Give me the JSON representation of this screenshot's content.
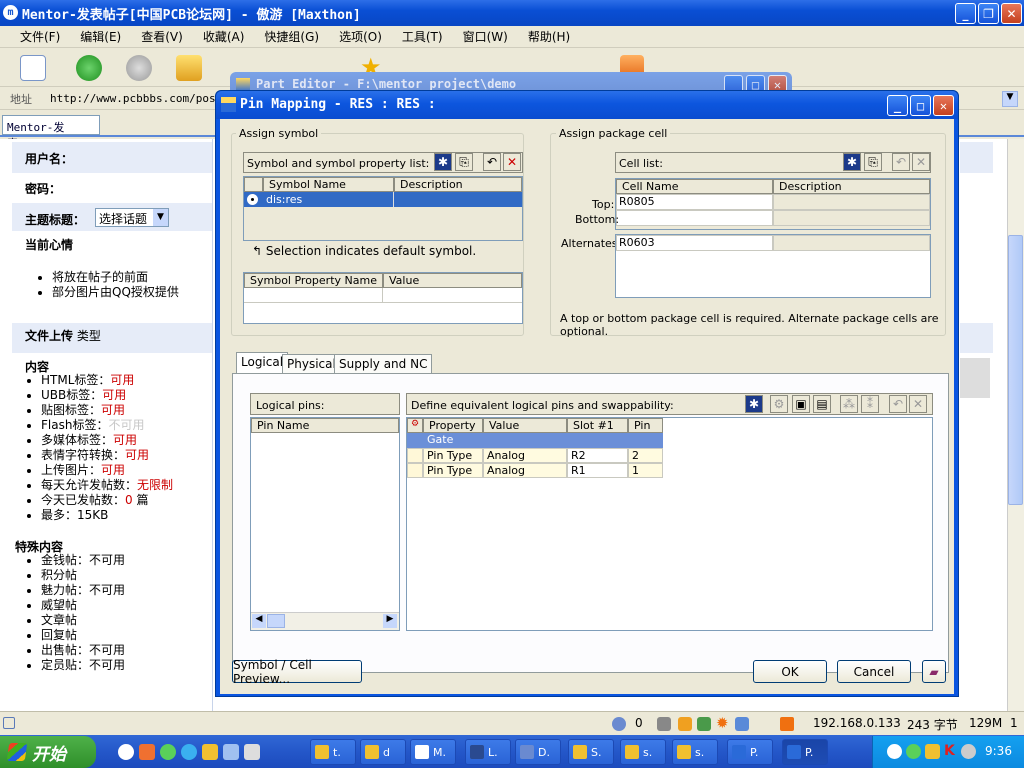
{
  "browser": {
    "title": "Mentor-发表帖子[中国PCB论坛网] - 傲游 [Maxthon]",
    "menu": [
      "文件(F)",
      "编辑(E)",
      "查看(V)",
      "收藏(A)",
      "快捷组(G)",
      "选项(O)",
      "工具(T)",
      "窗口(W)",
      "帮助(H)"
    ],
    "address_label": "地址",
    "address_value": "http://www.pcbbbs.com/pos",
    "tab_label": "Mentor-发表..."
  },
  "webpage": {
    "username_label": "用户名：",
    "password_label": "密码：",
    "topic_label": "主题标题：",
    "topic_select": "选择话题",
    "mood_label": "当前心情",
    "mood_items": [
      "将放在帖子的前面",
      "部分图片由QQ授权提供"
    ],
    "upload_label": "文件上传",
    "upload_type": "类型",
    "content_label": "内容",
    "content_items": [
      {
        "label": "HTML标签：",
        "value": "可用",
        "color": "#cc0000"
      },
      {
        "label": "UBB标签：",
        "value": "可用",
        "color": "#cc0000"
      },
      {
        "label": "贴图标签：",
        "value": "可用",
        "color": "#cc0000"
      },
      {
        "label": "Flash标签：",
        "value": "不可用",
        "color": "#c8c8c8"
      },
      {
        "label": "多媒体标签：",
        "value": "可用",
        "color": "#cc0000"
      },
      {
        "label": "表情字符转换：",
        "value": "可用",
        "color": "#cc0000"
      },
      {
        "label": "上传图片：",
        "value": "可用",
        "color": "#cc0000"
      },
      {
        "label": "每天允许发帖数：",
        "value": "无限制",
        "color": "#cc0000"
      },
      {
        "label": "今天已发帖数：",
        "value": "0",
        "color": "#cc0000",
        "suffix": " 篇"
      },
      {
        "label": "最多：15KB",
        "value": "",
        "color": "#000000"
      }
    ],
    "special_label": "特殊内容",
    "special_items": [
      "金钱帖：不可用",
      "积分帖",
      "魅力帖：不可用",
      "威望帖",
      "文章帖",
      "回复帖",
      "出售帖：不可用",
      "定员贴：不可用"
    ]
  },
  "part_editor": {
    "title": "Part Editor - F:\\mentor project\\demo"
  },
  "dialog": {
    "title": "Pin Mapping - RES : RES :",
    "assign_symbol": {
      "group_label": "Assign symbol",
      "list_label": "Symbol and symbol property list:",
      "columns": [
        "Symbol Name",
        "Description"
      ],
      "rows": [
        {
          "name": "dis:res",
          "description": ""
        }
      ],
      "hint": "Selection indicates default symbol.",
      "property_columns": [
        "Symbol Property Name",
        "Value"
      ]
    },
    "assign_package": {
      "group_label": "Assign package cell",
      "list_label": "Cell list:",
      "columns": [
        "Cell Name",
        "Description"
      ],
      "top_label": "Top:",
      "top_value": "R0805",
      "bottom_label": "Bottom:",
      "bottom_value": "",
      "alternates_label": "Alternates:",
      "alternates_value": "R0603",
      "note": "A top or bottom package cell is required.  Alternate package cells are optional."
    },
    "tabs": [
      "Logical",
      "Physical",
      "Supply and NC"
    ],
    "active_tab": "Logical",
    "logical": {
      "pins_label": "Logical pins:",
      "pin_column": "Pin Name",
      "define_label": "Define equivalent logical pins and swappability:",
      "columns": [
        "Property",
        "Value",
        "Slot #1",
        "Pin #"
      ],
      "gate_label": "Gate",
      "rows": [
        {
          "property": "Pin Type",
          "value": "Analog",
          "slot": "R2",
          "pin": "2"
        },
        {
          "property": "Pin Type",
          "value": "Analog",
          "slot": "R1",
          "pin": "1"
        }
      ]
    },
    "preview_button": "Symbol / Cell Preview...",
    "ok_button": "OK",
    "cancel_button": "Cancel"
  },
  "statusbar": {
    "count": "0",
    "ip": "192.168.0.133",
    "bytes": "243 字节",
    "mem": "129M",
    "num": "1"
  },
  "taskbar": {
    "start": "开始",
    "tasks": [
      "t.",
      "d",
      "M.",
      "L.",
      "D.",
      "S.",
      "s.",
      "s.",
      "P.",
      "P."
    ],
    "clock": "9:36"
  }
}
